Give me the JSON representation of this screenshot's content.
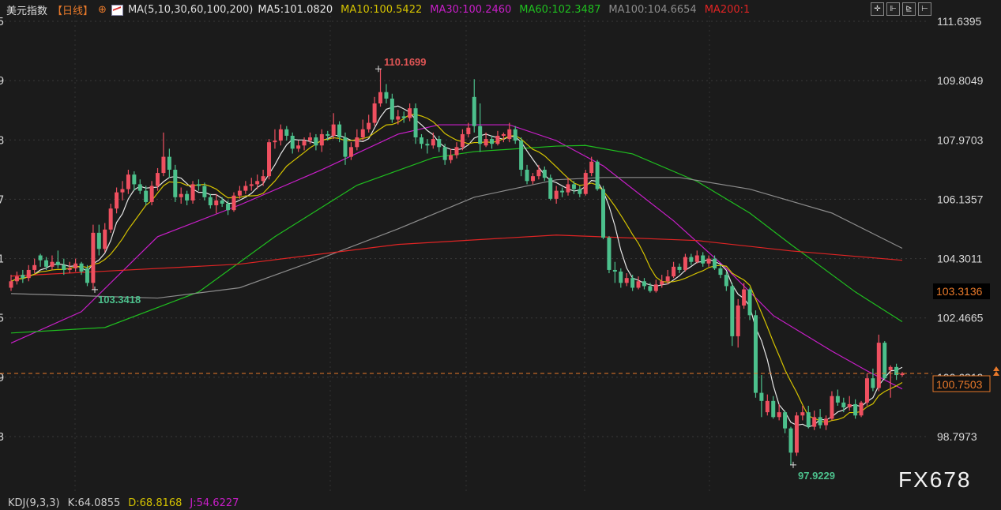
{
  "header": {
    "title": "美元指数",
    "period": "【日线】",
    "indicator": "MA(5,10,30,60,100,200)",
    "ma_values": [
      {
        "label": "MA5:101.0820",
        "color": "#e6e6e6"
      },
      {
        "label": "MA10:100.5422",
        "color": "#d4c200"
      },
      {
        "label": "MA30:100.2460",
        "color": "#c81ec8"
      },
      {
        "label": "MA60:102.3487",
        "color": "#1fbf1f"
      },
      {
        "label": "MA100:104.6654",
        "color": "#8c8c8c"
      },
      {
        "label": "MA200:1",
        "color": "#e02424"
      }
    ]
  },
  "toolbar": {
    "icons": [
      "crosshair-icon",
      "zoom-in-range-icon",
      "play-range-icon",
      "exit-range-icon"
    ],
    "glyphs": [
      "✛",
      "⊩",
      "⊵",
      "⊢"
    ]
  },
  "kdj": {
    "label": "KDJ(9,3,3)",
    "k": "K:64.0855",
    "d": "D:68.8168",
    "j": "J:54.6227",
    "colors": {
      "label": "#cccccc",
      "d": "#d4c200",
      "j": "#c81ec8"
    }
  },
  "watermark": "FX678",
  "colors": {
    "up": "#ef5060",
    "down": "#4cc08c",
    "background": "#1b1b1b",
    "current_price": "#e8792a"
  },
  "chart_data": {
    "type": "candlestick",
    "y_axis": {
      "ticks": [
        "111.6395",
        "109.8049",
        "107.9703",
        "106.1357",
        "104.3011",
        "102.4665",
        "100.6319",
        "98.7973"
      ],
      "left_tick_fragments": [
        "5",
        "9",
        "8",
        "7",
        "1",
        "5",
        "9",
        "3"
      ],
      "range": [
        96.9,
        112.3
      ]
    },
    "grid": true,
    "annotations": {
      "high": "110.1699",
      "low": "97.9229",
      "start_low": "103.3418"
    },
    "current_price": "100.7503",
    "marked_price": "103.3136",
    "candles_ohlc": [
      [
        103.4,
        103.8,
        103.3,
        103.6
      ],
      [
        103.6,
        103.9,
        103.5,
        103.75
      ],
      [
        103.8,
        103.95,
        103.55,
        103.7
      ],
      [
        103.7,
        104.1,
        103.6,
        103.95
      ],
      [
        103.95,
        104.3,
        103.85,
        104.1
      ],
      [
        104.4,
        104.45,
        104.05,
        104.25
      ],
      [
        104.25,
        104.35,
        103.95,
        104.05
      ],
      [
        104.05,
        104.4,
        103.95,
        104.2
      ],
      [
        104.2,
        104.55,
        104.0,
        104.1
      ],
      [
        104.1,
        104.3,
        103.8,
        103.95
      ],
      [
        103.95,
        104.2,
        103.85,
        104.0
      ],
      [
        104.0,
        104.3,
        103.9,
        104.15
      ],
      [
        104.15,
        104.2,
        103.8,
        103.9
      ],
      [
        104.0,
        104.1,
        103.45,
        103.55
      ],
      [
        103.55,
        105.35,
        103.34,
        105.1
      ],
      [
        105.1,
        105.35,
        104.4,
        104.6
      ],
      [
        104.6,
        105.4,
        104.5,
        105.2
      ],
      [
        105.2,
        106.0,
        105.1,
        105.85
      ],
      [
        105.85,
        106.5,
        105.7,
        106.35
      ],
      [
        106.35,
        106.7,
        106.1,
        106.45
      ],
      [
        106.45,
        107.05,
        106.3,
        106.9
      ],
      [
        106.9,
        107.0,
        106.4,
        106.6
      ],
      [
        106.6,
        106.75,
        106.3,
        106.4
      ],
      [
        106.4,
        106.55,
        105.95,
        106.05
      ],
      [
        106.05,
        106.7,
        105.95,
        106.55
      ],
      [
        106.55,
        107.1,
        106.4,
        106.95
      ],
      [
        106.95,
        108.2,
        106.85,
        107.45
      ],
      [
        107.45,
        107.7,
        106.8,
        107.05
      ],
      [
        107.05,
        107.2,
        106.05,
        106.2
      ],
      [
        106.2,
        106.5,
        106.0,
        106.3
      ],
      [
        106.3,
        106.4,
        105.95,
        106.1
      ],
      [
        106.1,
        106.7,
        106.0,
        106.6
      ],
      [
        106.6,
        106.75,
        106.4,
        106.55
      ],
      [
        106.55,
        106.65,
        106.1,
        106.2
      ],
      [
        106.2,
        106.3,
        105.85,
        105.95
      ],
      [
        105.95,
        106.3,
        105.7,
        106.1
      ],
      [
        106.1,
        106.2,
        105.9,
        106.0
      ],
      [
        106.0,
        106.1,
        105.65,
        105.8
      ],
      [
        105.8,
        106.35,
        105.75,
        106.25
      ],
      [
        106.25,
        106.55,
        106.15,
        106.4
      ],
      [
        106.4,
        106.7,
        106.3,
        106.55
      ],
      [
        106.55,
        106.8,
        106.4,
        106.6
      ],
      [
        106.6,
        106.9,
        106.45,
        106.7
      ],
      [
        106.7,
        107.05,
        106.55,
        106.85
      ],
      [
        106.85,
        108.0,
        106.75,
        107.9
      ],
      [
        107.9,
        108.3,
        107.7,
        107.95
      ],
      [
        107.95,
        108.45,
        107.8,
        108.3
      ],
      [
        108.3,
        108.4,
        107.95,
        108.1
      ],
      [
        108.1,
        108.2,
        107.55,
        107.7
      ],
      [
        107.7,
        107.95,
        107.6,
        107.8
      ],
      [
        107.8,
        108.05,
        107.65,
        107.95
      ],
      [
        107.95,
        108.2,
        107.85,
        108.05
      ],
      [
        108.05,
        108.15,
        107.65,
        107.8
      ],
      [
        107.8,
        108.3,
        107.6,
        108.15
      ],
      [
        108.15,
        108.25,
        107.95,
        108.1
      ],
      [
        108.1,
        108.8,
        108.0,
        108.45
      ],
      [
        108.45,
        108.55,
        107.9,
        108.05
      ],
      [
        108.05,
        108.2,
        107.2,
        107.45
      ],
      [
        107.45,
        107.9,
        107.35,
        107.75
      ],
      [
        107.75,
        108.3,
        107.65,
        108.05
      ],
      [
        108.05,
        108.6,
        107.95,
        108.3
      ],
      [
        108.3,
        108.75,
        108.2,
        108.5
      ],
      [
        108.5,
        109.3,
        108.4,
        109.1
      ],
      [
        109.1,
        110.17,
        109.0,
        109.45
      ],
      [
        109.45,
        109.7,
        109.1,
        109.25
      ],
      [
        109.25,
        109.4,
        108.5,
        108.6
      ],
      [
        108.6,
        108.9,
        108.45,
        108.7
      ],
      [
        108.7,
        108.85,
        108.5,
        108.65
      ],
      [
        108.65,
        109.1,
        108.55,
        108.95
      ],
      [
        108.95,
        109.1,
        107.85,
        108.05
      ],
      [
        108.05,
        108.15,
        107.7,
        107.85
      ],
      [
        107.85,
        108.0,
        107.55,
        107.8
      ],
      [
        107.8,
        108.2,
        107.7,
        108.0
      ],
      [
        108.0,
        108.1,
        107.6,
        107.75
      ],
      [
        107.75,
        107.85,
        107.2,
        107.35
      ],
      [
        107.35,
        107.7,
        107.25,
        107.5
      ],
      [
        107.5,
        107.9,
        107.4,
        107.75
      ],
      [
        107.75,
        108.3,
        107.65,
        108.15
      ],
      [
        108.15,
        108.5,
        108.05,
        108.35
      ],
      [
        109.3,
        109.85,
        108.2,
        108.4
      ],
      [
        108.4,
        109.1,
        107.6,
        107.85
      ],
      [
        107.8,
        108.2,
        107.75,
        108.0
      ],
      [
        108.0,
        108.1,
        107.7,
        107.85
      ],
      [
        107.85,
        108.25,
        107.8,
        108.1
      ],
      [
        108.1,
        108.2,
        107.9,
        108.15
      ],
      [
        108.0,
        108.5,
        107.9,
        108.3
      ],
      [
        108.3,
        108.4,
        107.85,
        107.95
      ],
      [
        107.95,
        108.05,
        106.85,
        107.05
      ],
      [
        107.05,
        107.2,
        106.6,
        106.7
      ],
      [
        106.7,
        106.95,
        106.6,
        106.85
      ],
      [
        106.85,
        107.2,
        106.75,
        107.05
      ],
      [
        107.05,
        107.15,
        106.7,
        106.8
      ],
      [
        106.8,
        106.9,
        106.1,
        106.15
      ],
      [
        106.15,
        106.55,
        106.0,
        106.4
      ],
      [
        106.4,
        106.5,
        106.2,
        106.35
      ],
      [
        106.35,
        106.8,
        106.25,
        106.6
      ],
      [
        106.6,
        106.7,
        106.3,
        106.45
      ],
      [
        106.45,
        106.55,
        106.2,
        106.3
      ],
      [
        106.3,
        107.05,
        106.25,
        106.95
      ],
      [
        106.95,
        107.45,
        106.85,
        107.3
      ],
      [
        107.3,
        107.35,
        106.4,
        106.45
      ],
      [
        106.45,
        106.55,
        104.9,
        104.95
      ],
      [
        104.95,
        105.0,
        103.85,
        103.95
      ],
      [
        103.95,
        104.2,
        103.55,
        103.9
      ],
      [
        103.9,
        104.0,
        103.4,
        103.55
      ],
      [
        103.55,
        103.85,
        103.45,
        103.7
      ],
      [
        103.7,
        103.8,
        103.3,
        103.4
      ],
      [
        103.4,
        103.75,
        103.35,
        103.6
      ],
      [
        103.6,
        103.7,
        103.35,
        103.45
      ],
      [
        103.45,
        103.55,
        103.25,
        103.3
      ],
      [
        103.3,
        103.65,
        103.25,
        103.5
      ],
      [
        103.5,
        103.8,
        103.4,
        103.6
      ],
      [
        103.6,
        103.95,
        103.5,
        103.75
      ],
      [
        103.75,
        104.2,
        103.7,
        104.05
      ],
      [
        104.05,
        104.15,
        103.85,
        103.95
      ],
      [
        103.95,
        104.45,
        103.9,
        104.35
      ],
      [
        104.35,
        104.45,
        104.1,
        104.2
      ],
      [
        104.2,
        104.55,
        104.15,
        104.4
      ],
      [
        104.4,
        104.5,
        104.05,
        104.15
      ],
      [
        104.15,
        104.4,
        104.05,
        104.3
      ],
      [
        104.3,
        104.4,
        103.95,
        104.0
      ],
      [
        104.0,
        104.1,
        103.7,
        103.8
      ],
      [
        103.8,
        103.9,
        103.3,
        103.45
      ],
      [
        103.45,
        103.55,
        101.6,
        101.9
      ],
      [
        101.9,
        103.05,
        101.55,
        102.85
      ],
      [
        102.85,
        103.55,
        102.75,
        103.35
      ],
      [
        103.35,
        103.4,
        102.4,
        102.55
      ],
      [
        102.55,
        102.7,
        100.0,
        100.15
      ],
      [
        100.15,
        100.7,
        99.4,
        99.9
      ],
      [
        99.55,
        100.1,
        99.45,
        99.9
      ],
      [
        99.9,
        100.05,
        99.35,
        99.4
      ],
      [
        99.4,
        99.8,
        99.3,
        99.55
      ],
      [
        99.55,
        99.6,
        98.9,
        99.05
      ],
      [
        99.05,
        99.1,
        97.92,
        98.3
      ],
      [
        98.3,
        99.55,
        98.2,
        99.45
      ],
      [
        99.45,
        99.75,
        99.3,
        99.55
      ],
      [
        99.55,
        99.75,
        99.05,
        99.1
      ],
      [
        99.1,
        99.6,
        99.0,
        99.4
      ],
      [
        99.4,
        99.65,
        99.05,
        99.15
      ],
      [
        99.15,
        99.45,
        99.0,
        99.35
      ],
      [
        99.35,
        100.2,
        99.3,
        100.05
      ],
      [
        100.05,
        100.25,
        99.75,
        99.85
      ],
      [
        99.85,
        100.0,
        99.55,
        99.7
      ],
      [
        99.7,
        100.05,
        99.6,
        99.8
      ],
      [
        99.8,
        99.95,
        99.35,
        99.45
      ],
      [
        99.45,
        99.9,
        99.4,
        99.85
      ],
      [
        99.85,
        100.75,
        99.75,
        100.6
      ],
      [
        100.6,
        100.9,
        100.2,
        100.3
      ],
      [
        100.3,
        101.95,
        100.2,
        101.7
      ],
      [
        101.7,
        101.75,
        100.55,
        100.6
      ],
      [
        100.85,
        101.0,
        100.0,
        100.95
      ],
      [
        100.95,
        101.05,
        100.55,
        100.7
      ],
      [
        100.7,
        100.8,
        100.65,
        100.75
      ]
    ],
    "moving_averages": [
      {
        "name": "MA30",
        "color": "#c81ec8",
        "points": [
          [
            0,
            101.69
          ],
          [
            12,
            102.66
          ],
          [
            25,
            104.98
          ],
          [
            39,
            105.96
          ],
          [
            53,
            107.05
          ],
          [
            66,
            108.15
          ],
          [
            73,
            108.44
          ],
          [
            85,
            108.44
          ],
          [
            93,
            107.95
          ],
          [
            101,
            107.17
          ],
          [
            113,
            105.47
          ],
          [
            122,
            104.0
          ],
          [
            130,
            102.54
          ],
          [
            140,
            101.44
          ],
          [
            146,
            100.83
          ],
          [
            152,
            100.27
          ]
        ]
      },
      {
        "name": "MA60",
        "color": "#1fbf1f",
        "points": [
          [
            0,
            102.0
          ],
          [
            16,
            102.17
          ],
          [
            32,
            103.27
          ],
          [
            45,
            104.98
          ],
          [
            59,
            106.57
          ],
          [
            72,
            107.42
          ],
          [
            79,
            107.61
          ],
          [
            93,
            107.78
          ],
          [
            98,
            107.8
          ],
          [
            106,
            107.54
          ],
          [
            117,
            106.69
          ],
          [
            126,
            105.71
          ],
          [
            133,
            104.74
          ],
          [
            144,
            103.27
          ],
          [
            152,
            102.35
          ]
        ]
      },
      {
        "name": "MA100",
        "color": "#8c8c8c",
        "points": [
          [
            0,
            103.22
          ],
          [
            25,
            103.08
          ],
          [
            39,
            103.4
          ],
          [
            52,
            104.25
          ],
          [
            66,
            105.22
          ],
          [
            79,
            106.2
          ],
          [
            93,
            106.74
          ],
          [
            101,
            106.81
          ],
          [
            114,
            106.81
          ],
          [
            126,
            106.45
          ],
          [
            140,
            105.71
          ],
          [
            152,
            104.62
          ]
        ]
      },
      {
        "name": "MA200",
        "color": "#e02424",
        "points": [
          [
            0,
            103.76
          ],
          [
            39,
            104.13
          ],
          [
            66,
            104.74
          ],
          [
            93,
            105.03
          ],
          [
            117,
            104.86
          ],
          [
            133,
            104.54
          ],
          [
            152,
            104.25
          ]
        ]
      }
    ],
    "computed_ma": [
      {
        "name": "MA5",
        "period": 5,
        "color": "#e6e6e6"
      },
      {
        "name": "MA10",
        "period": 10,
        "color": "#d4c200"
      }
    ]
  }
}
